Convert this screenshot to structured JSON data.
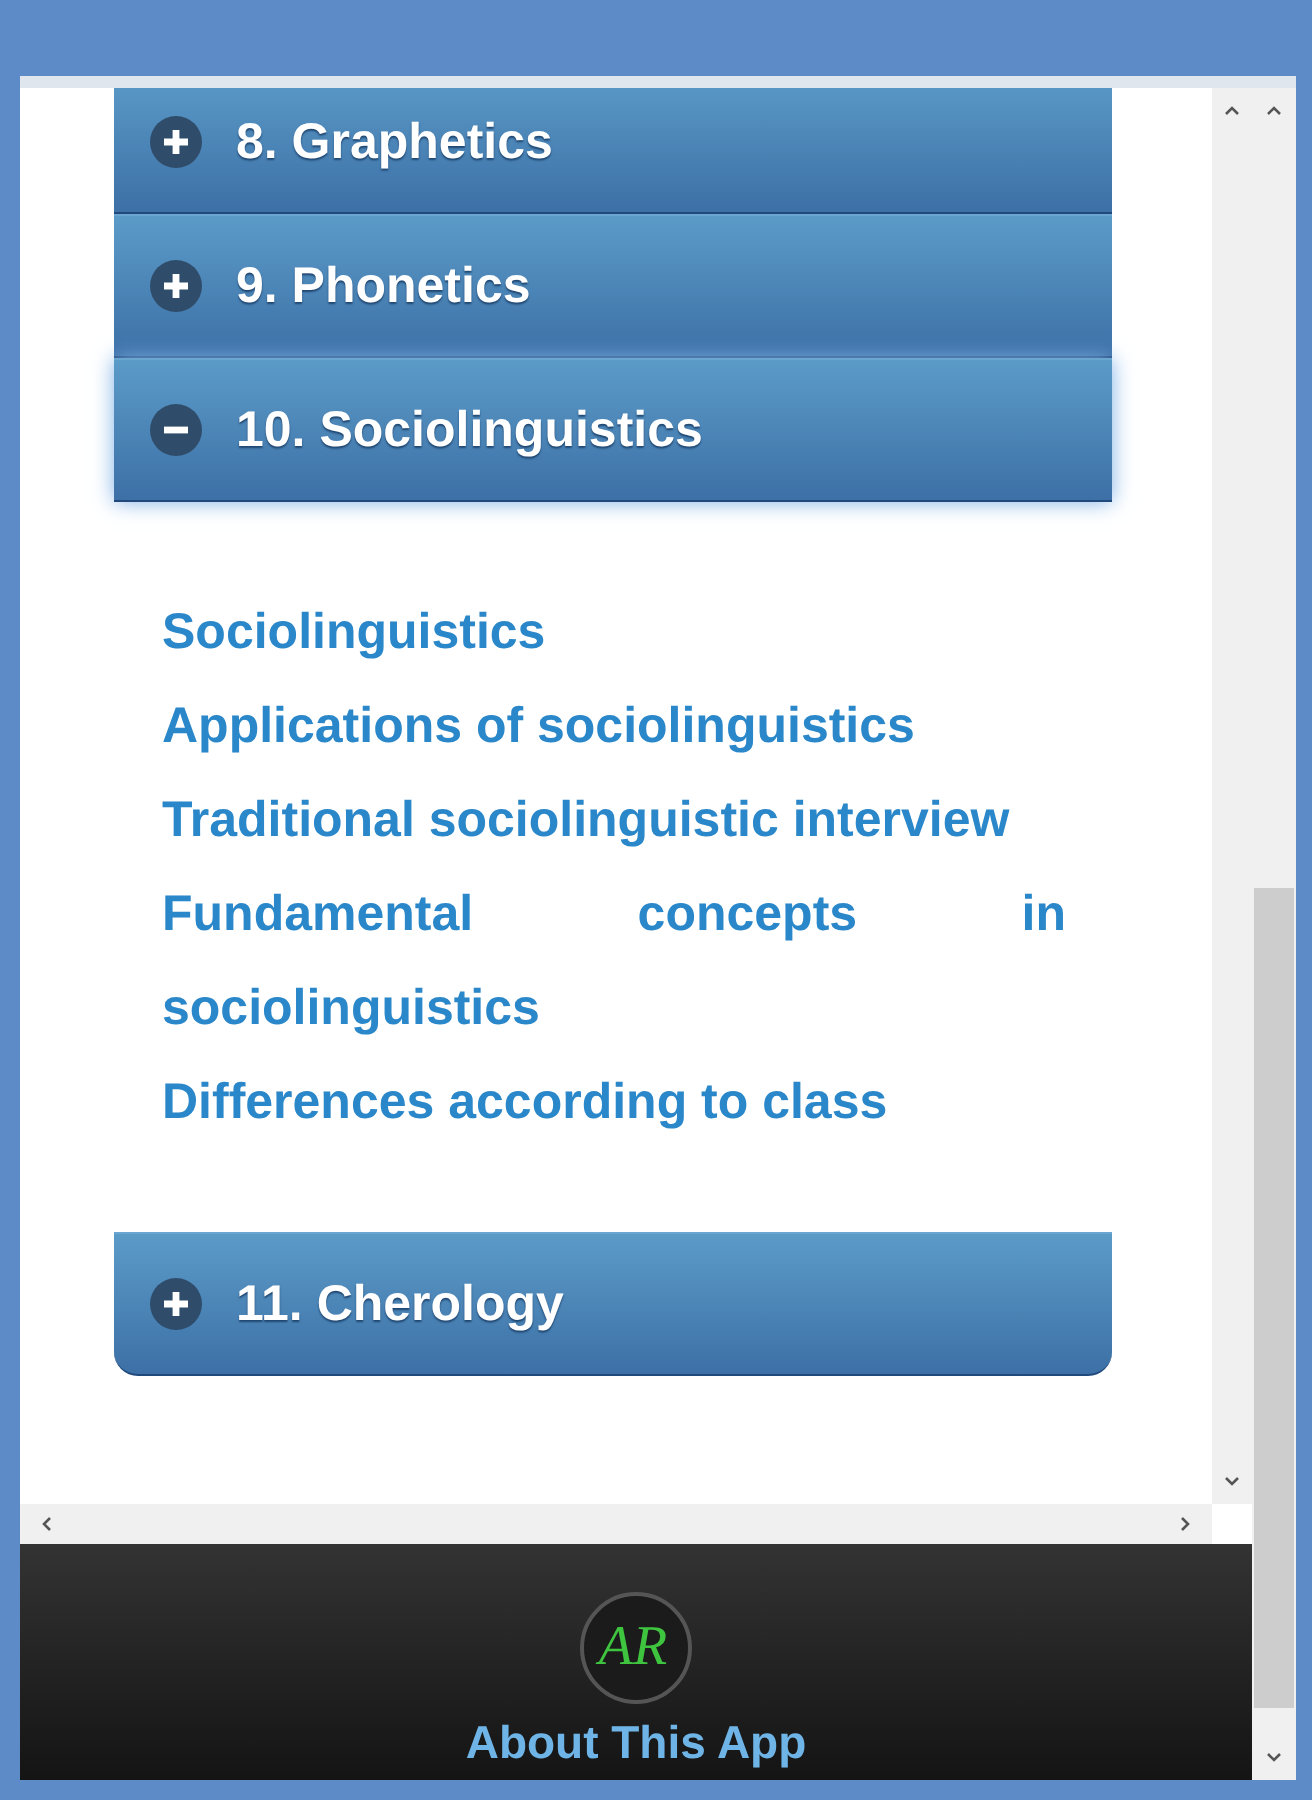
{
  "sections": [
    {
      "title": "8. Graphetics",
      "expanded": false
    },
    {
      "title": "9. Phonetics",
      "expanded": false
    },
    {
      "title": "10. Sociolinguistics",
      "expanded": true,
      "links": [
        "Sociolinguistics",
        "Applications of sociolinguistics",
        "Traditional sociolinguistic interview",
        "Fundamental concepts in sociolinguistics",
        "Differences according to class"
      ]
    },
    {
      "title": "11. Cherology",
      "expanded": false
    }
  ],
  "footer": {
    "logo_text": "AR",
    "label": "About This App"
  }
}
